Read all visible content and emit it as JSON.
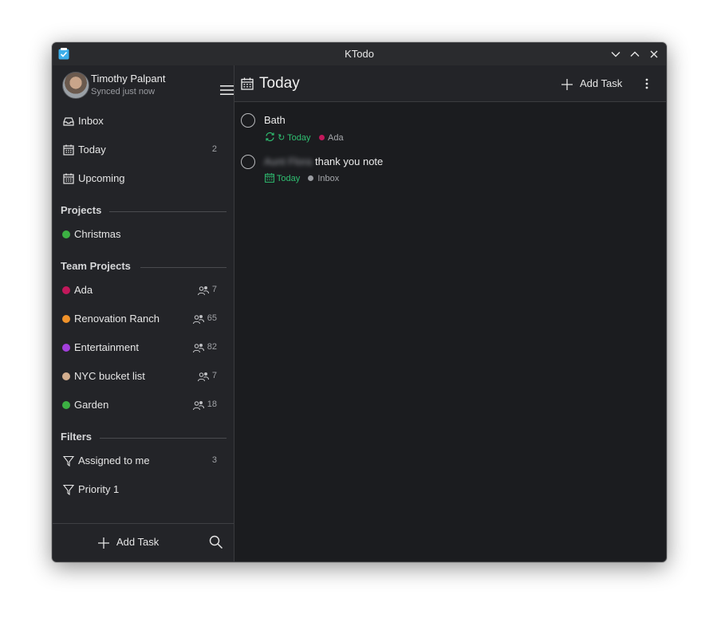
{
  "window": {
    "title": "KTodo"
  },
  "colors": {
    "accent_green": "#2fbf71",
    "ada": "#c2185b",
    "christmas": "#3cb043",
    "renovation": "#f0922a",
    "entertainment": "#a33fdc",
    "nyc": "#d2ad8e",
    "garden": "#3cb043",
    "inbox": "#9a9ca1"
  },
  "user": {
    "name": "Timothy Palpant",
    "status": "Synced just now"
  },
  "nav": [
    {
      "label": "Inbox",
      "icon": "inbox-icon",
      "count": ""
    },
    {
      "label": "Today",
      "icon": "calendar-icon",
      "count": "2"
    },
    {
      "label": "Upcoming",
      "icon": "calendar-icon",
      "count": ""
    }
  ],
  "sections": {
    "projects": "Projects",
    "team": "Team Projects",
    "filters": "Filters"
  },
  "projects": [
    {
      "label": "Christmas",
      "color": "#3cb043"
    }
  ],
  "team_projects": [
    {
      "label": "Ada",
      "color": "#c2185b",
      "count": "7"
    },
    {
      "label": "Renovation Ranch",
      "color": "#f0922a",
      "count": "65"
    },
    {
      "label": "Entertainment",
      "color": "#a33fdc",
      "count": "82"
    },
    {
      "label": "NYC bucket list",
      "color": "#d2ad8e",
      "count": "7"
    },
    {
      "label": "Garden",
      "color": "#3cb043",
      "count": "18"
    }
  ],
  "filters": [
    {
      "label": "Assigned to me",
      "count": "3"
    },
    {
      "label": "Priority 1",
      "count": ""
    }
  ],
  "sidebar_footer": {
    "add_label": "Add Task"
  },
  "main": {
    "title": "Today",
    "add_label": "Add Task",
    "tasks": [
      {
        "title": "Bath",
        "blurred": "",
        "due": "↻ Today",
        "project": "Ada",
        "project_color": "#c2185b"
      },
      {
        "title": "thank you note",
        "blurred": "Aunt Flora",
        "due": "Today",
        "project": "Inbox",
        "project_color": "#9a9ca1"
      }
    ]
  }
}
